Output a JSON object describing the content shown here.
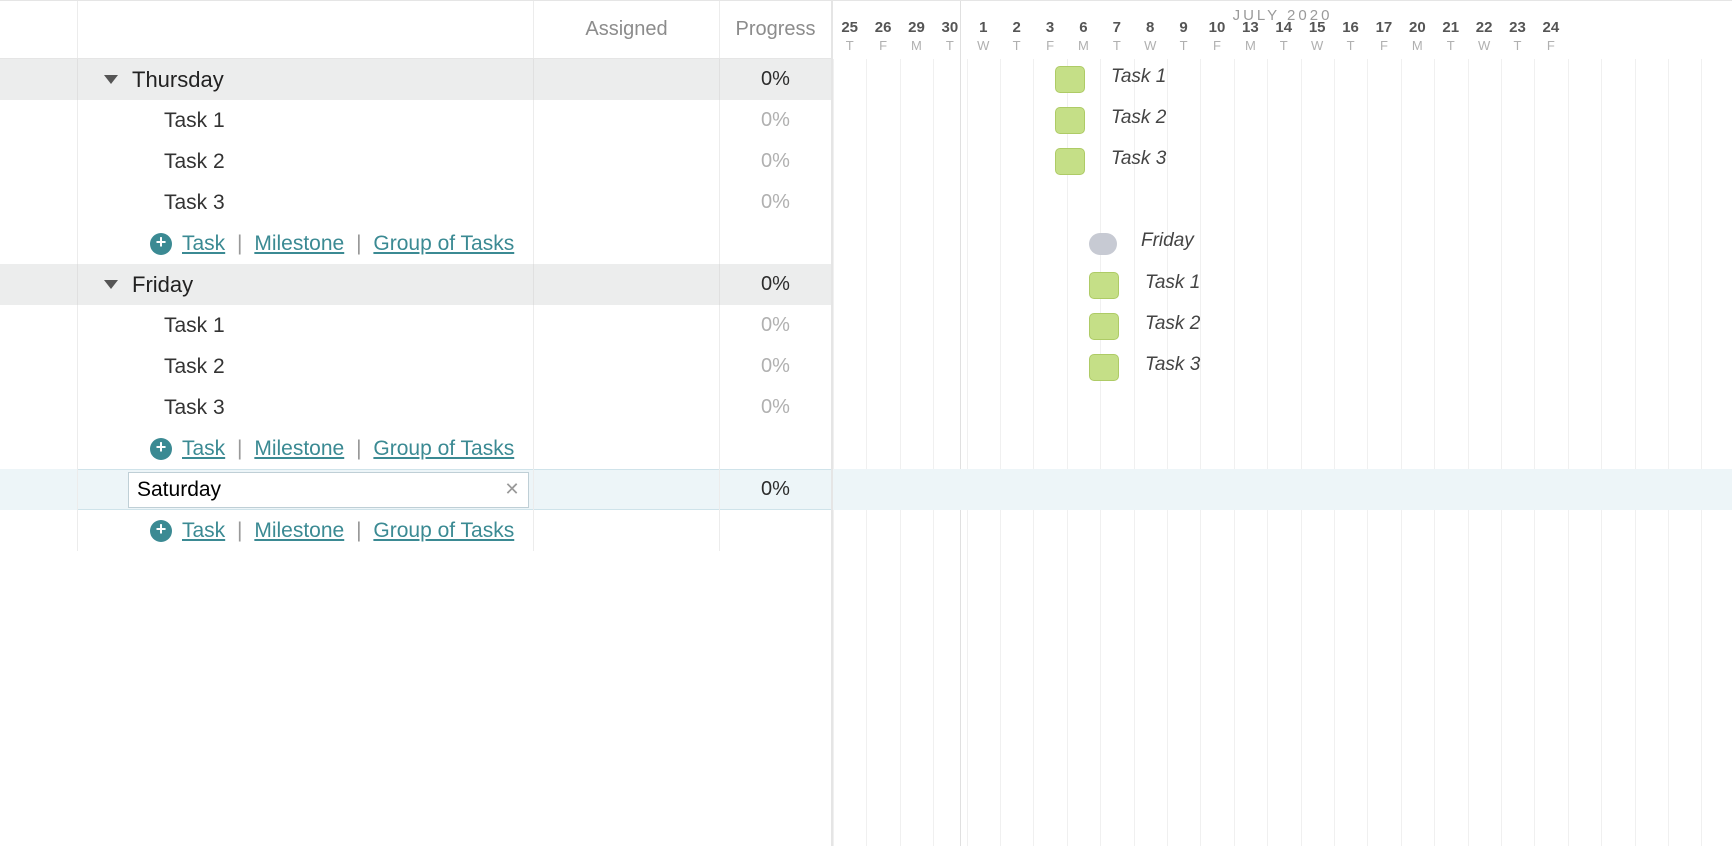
{
  "columns": {
    "assigned": "Assigned",
    "progress": "Progress"
  },
  "timeline_header": "JULY 2020",
  "days": [
    {
      "d": "25",
      "w": "T"
    },
    {
      "d": "26",
      "w": "F"
    },
    {
      "d": "29",
      "w": "M"
    },
    {
      "d": "30",
      "w": "T"
    },
    {
      "d": "1",
      "w": "W"
    },
    {
      "d": "2",
      "w": "T"
    },
    {
      "d": "3",
      "w": "F"
    },
    {
      "d": "6",
      "w": "M"
    },
    {
      "d": "7",
      "w": "T"
    },
    {
      "d": "8",
      "w": "W"
    },
    {
      "d": "9",
      "w": "T"
    },
    {
      "d": "10",
      "w": "F"
    },
    {
      "d": "13",
      "w": "M"
    },
    {
      "d": "14",
      "w": "T"
    },
    {
      "d": "15",
      "w": "W"
    },
    {
      "d": "16",
      "w": "T"
    },
    {
      "d": "17",
      "w": "F"
    },
    {
      "d": "20",
      "w": "M"
    },
    {
      "d": "21",
      "w": "T"
    },
    {
      "d": "22",
      "w": "W"
    },
    {
      "d": "23",
      "w": "T"
    },
    {
      "d": "24",
      "w": "F"
    }
  ],
  "groups": {
    "thursday": {
      "name": "Thursday",
      "progress": "0%",
      "tasks": {
        "t1": {
          "name": "Task 1",
          "progress": "0%"
        },
        "t2": {
          "name": "Task 2",
          "progress": "0%"
        },
        "t3": {
          "name": "Task 3",
          "progress": "0%"
        }
      }
    },
    "friday": {
      "name": "Friday",
      "progress": "0%",
      "tasks": {
        "t1": {
          "name": "Task 1",
          "progress": "0%"
        },
        "t2": {
          "name": "Task 2",
          "progress": "0%"
        },
        "t3": {
          "name": "Task 3",
          "progress": "0%"
        }
      }
    },
    "saturday": {
      "name_input": "Saturday",
      "progress": "0%"
    }
  },
  "add_links": {
    "task": "Task",
    "milestone": "Milestone",
    "group": "Group of Tasks"
  },
  "gantt": {
    "thursday": {
      "t1": {
        "label": "Task 1"
      },
      "t2": {
        "label": "Task 2"
      },
      "t3": {
        "label": "Task 3"
      }
    },
    "friday": {
      "group_label": "Friday",
      "t1": {
        "label": "Task 1"
      },
      "t2": {
        "label": "Task 2"
      },
      "t3": {
        "label": "Task 3"
      }
    }
  }
}
